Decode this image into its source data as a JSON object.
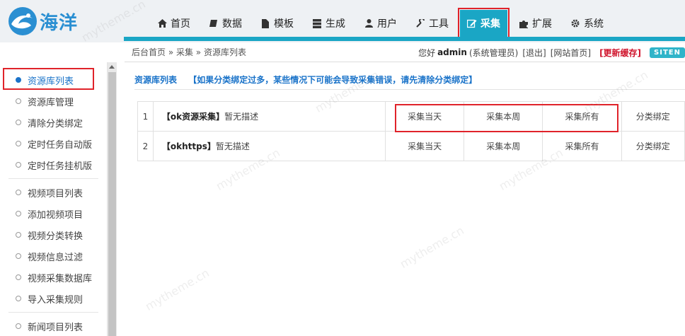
{
  "logo": {
    "text": "海洋"
  },
  "nav": [
    {
      "label": "首页",
      "icon": "home-icon"
    },
    {
      "label": "数据",
      "icon": "database-icon"
    },
    {
      "label": "模板",
      "icon": "file-icon"
    },
    {
      "label": "生成",
      "icon": "server-icon"
    },
    {
      "label": "用户",
      "icon": "user-icon"
    },
    {
      "label": "工具",
      "icon": "wrench-icon"
    },
    {
      "label": "采集",
      "icon": "edit-icon",
      "active": true
    },
    {
      "label": "扩展",
      "icon": "puzzle-icon"
    },
    {
      "label": "系统",
      "icon": "gear-icon"
    }
  ],
  "breadcrumb": {
    "text": "后台首页 » 采集 » 资源库列表"
  },
  "user_bar": {
    "greeting": "您好",
    "username": "admin",
    "role": "(系统管理员)",
    "logout": "[退出]",
    "site_home": "[网站首页]",
    "refresh_cache": "[更新缓存]",
    "site_btn": "SITEN"
  },
  "sidebar": {
    "items": [
      {
        "label": "资源库列表",
        "active": true
      },
      {
        "label": "资源库管理"
      },
      {
        "label": "清除分类绑定"
      },
      {
        "label": "定时任务自动版"
      },
      {
        "label": "定时任务挂机版"
      },
      {
        "label": "视频项目列表"
      },
      {
        "label": "添加视频项目"
      },
      {
        "label": "视频分类转换"
      },
      {
        "label": "视频信息过滤"
      },
      {
        "label": "视频采集数据库"
      },
      {
        "label": "导入采集规则"
      },
      {
        "label": "新闻项目列表"
      }
    ]
  },
  "content": {
    "title": "资源库列表",
    "note": "【如果分类绑定过多，某些情况下可能会导致采集错误，请先清除分类绑定】",
    "rows": [
      {
        "index": "1",
        "name": "【ok资源采集】",
        "desc": "暂无描述",
        "today": "采集当天",
        "week": "采集本周",
        "all": "采集所有",
        "bind": "分类绑定"
      },
      {
        "index": "2",
        "name": "【okhttps】",
        "desc": "暂无描述",
        "today": "采集当天",
        "week": "采集本周",
        "all": "采集所有",
        "bind": "分类绑定"
      }
    ]
  },
  "watermark": "mytheme.cn",
  "colors": {
    "accent": "#1aa6c5",
    "highlight": "#e0232a",
    "link": "#1a73c9"
  }
}
